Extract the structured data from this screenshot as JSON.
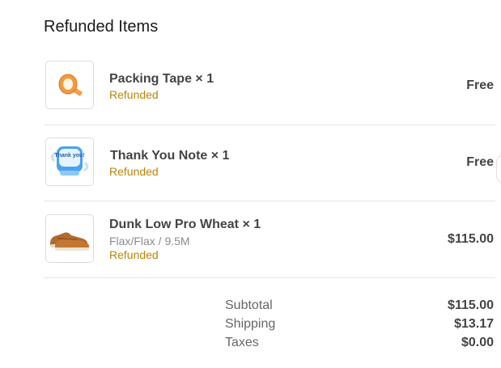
{
  "section_title": "Refunded Items",
  "items": [
    {
      "name": "Packing Tape × 1",
      "variant": "",
      "status": "Refunded",
      "price": "Free",
      "icon": "packing-tape-icon"
    },
    {
      "name": "Thank You Note × 1",
      "variant": "",
      "status": "Refunded",
      "price": "Free",
      "icon": "thank-you-card-icon",
      "card_text": "Thank you!"
    },
    {
      "name": "Dunk Low Pro Wheat × 1",
      "variant": "Flax/Flax / 9.5M",
      "status": "Refunded",
      "price": "$115.00",
      "icon": "sneaker-icon"
    }
  ],
  "summary": {
    "subtotal_label": "Subtotal",
    "subtotal_value": "$115.00",
    "shipping_label": "Shipping",
    "shipping_value": "$13.17",
    "taxes_label": "Taxes",
    "taxes_value": "$0.00"
  },
  "colors": {
    "status": "#b8860b",
    "divider": "#e3e3e3"
  }
}
